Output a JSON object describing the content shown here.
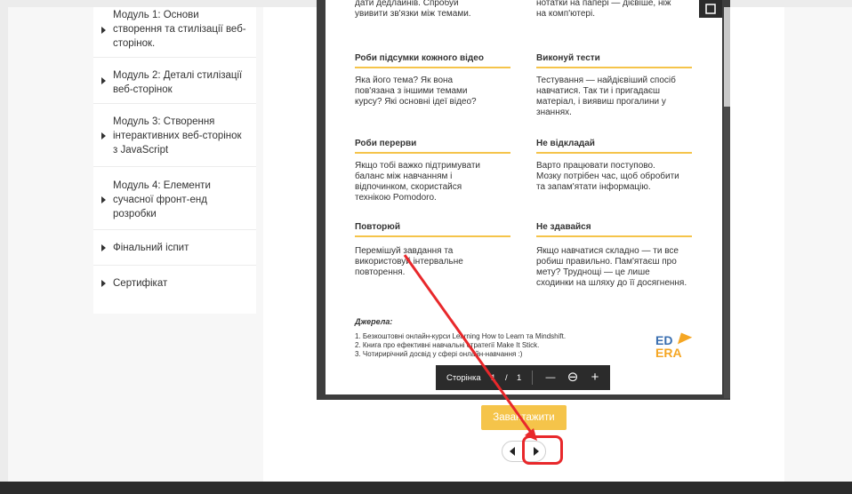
{
  "sidebar": {
    "items": [
      {
        "label": "Модуль 1: Основи\nстворення та стилізації веб-\nсторінок."
      },
      {
        "label": "Модуль 2: Деталі стилізації\nвеб-сторінок"
      },
      {
        "label": "Модуль 3: Створення\nінтерактивних веб-сторінок\nз JavaScript"
      },
      {
        "label": "Модуль 4: Елементи\nсучасної фронт-енд\nрозробки"
      },
      {
        "label": "Фінальний іспит"
      },
      {
        "label": "Сертифікат"
      }
    ]
  },
  "document": {
    "top_left_text": "дати дедлайнів. Спробуй\nувивити зв'язки між темами.",
    "top_right_text": "нотатки на папері — дієвіше, ніж\nна комп'ютері.",
    "tips": [
      {
        "heading": "Роби підсумки кожного відео",
        "text": "Яка його тема? Як вона\nпов'язана з іншими темами\nкурсу? Які основні ідеї відео?"
      },
      {
        "heading": "Виконуй тести",
        "text": "Тестування — найдієвіший спосіб\nнавчатися. Так ти і пригадаєш\nматеріал, і виявиш прогалини у\nзнаннях."
      },
      {
        "heading": "Роби перерви",
        "text": "Якщо тобі важко підтримувати\nбаланс між навчанням і\nвідпочинком, скористайся\nтехнікою Pomodoro."
      },
      {
        "heading": "Не відкладай",
        "text": "Варто працювати поступово.\nМозку потрібен час, щоб обробити\nта запам'ятати інформацію."
      },
      {
        "heading": "Повторюй",
        "text": "Перемішуй завдання та\nвикористовуй інтервальне\nповторення."
      },
      {
        "heading": "Не здавайся",
        "text": "Якщо навчатися складно — ти все\nробиш правильно. Пам'ятаєш про\nмету? Труднощі — це лише\nсходинки на шляху до її досягнення."
      }
    ],
    "sources_title": "Джерела:",
    "sources": [
      "1. Безкоштовні онлайн-курси Learning How to Learn та Mindshift.",
      "2. Книга про ефективні навчальні стратегії Make It Stick.",
      "3. Чотирирічний досвід у сфері онлайн-навчання :)"
    ],
    "logo": {
      "line1": "ED",
      "line2": "ERA"
    }
  },
  "viewer_toolbar": {
    "page_label": "Сторінка",
    "current_page": "1",
    "separator": "/",
    "total_pages": "1",
    "zoom_out": "—",
    "zoom_icon": "⊖",
    "zoom_in": "+"
  },
  "download_button": "Завантажити",
  "colors": {
    "accent": "#f5c44a",
    "annotation": "#e8282b"
  }
}
